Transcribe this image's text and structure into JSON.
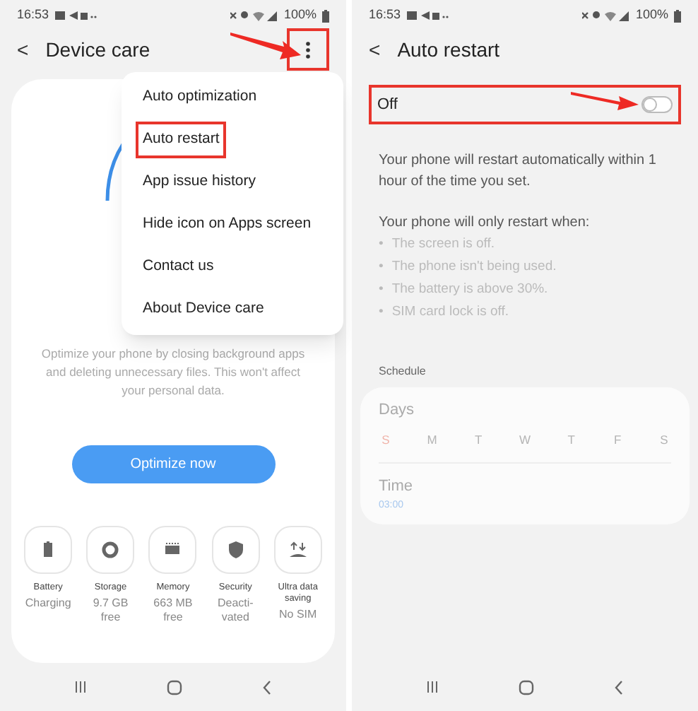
{
  "left_screen": {
    "status_bar": {
      "time": "16:53",
      "battery": "100%"
    },
    "header": {
      "back": "<",
      "title": "Device care",
      "menu_highlighted": true
    },
    "menu": [
      {
        "label": "Auto optimization",
        "highlighted": false
      },
      {
        "label": "Auto restart",
        "highlighted": true
      },
      {
        "label": "App issue history",
        "highlighted": false
      },
      {
        "label": "Hide icon on Apps screen",
        "highlighted": false
      },
      {
        "label": "Contact us",
        "highlighted": false
      },
      {
        "label": "About Device care",
        "highlighted": false
      }
    ],
    "description": "Optimize your phone by closing background apps and deleting unnecessary files. This won't affect your personal data.",
    "optimize_button": "Optimize now",
    "tiles": [
      {
        "kind": "battery",
        "label": "Battery",
        "value": "Charging"
      },
      {
        "kind": "storage",
        "label": "Storage",
        "value": "9.7 GB free"
      },
      {
        "kind": "memory",
        "label": "Memory",
        "value": "663 MB free"
      },
      {
        "kind": "security",
        "label": "Security",
        "value": "Deacti-vated"
      },
      {
        "kind": "data",
        "label": "Ultra data saving",
        "value": "No SIM"
      }
    ]
  },
  "right_screen": {
    "status_bar": {
      "time": "16:53",
      "battery": "100%"
    },
    "header": {
      "back": "<",
      "title": "Auto restart"
    },
    "switch_row": {
      "label": "Off",
      "on": false,
      "highlighted": true
    },
    "info": "Your phone will restart automatically within 1 hour of the time you set.",
    "conditions_title": "Your phone will only restart when:",
    "conditions": [
      {
        "bullet": "•",
        "text": "The screen is off."
      },
      {
        "bullet": "•",
        "text": "The phone isn't being used."
      },
      {
        "bullet": "•",
        "text": "The battery is above 30%."
      },
      {
        "bullet": "•",
        "text": "SIM card lock is off."
      }
    ],
    "schedule_label": "Schedule",
    "days_label": "Days",
    "days": [
      {
        "letter": "S",
        "color": "#f0b4aa"
      },
      {
        "letter": "M",
        "color": "#b4b4b4"
      },
      {
        "letter": "T",
        "color": "#b4b4b4"
      },
      {
        "letter": "W",
        "color": "#b4b4b4"
      },
      {
        "letter": "T",
        "color": "#b4b4b4"
      },
      {
        "letter": "F",
        "color": "#b4b4b4"
      },
      {
        "letter": "S",
        "color": "#b4b4b4"
      }
    ],
    "time_label": "Time",
    "time_value": "03:00"
  }
}
